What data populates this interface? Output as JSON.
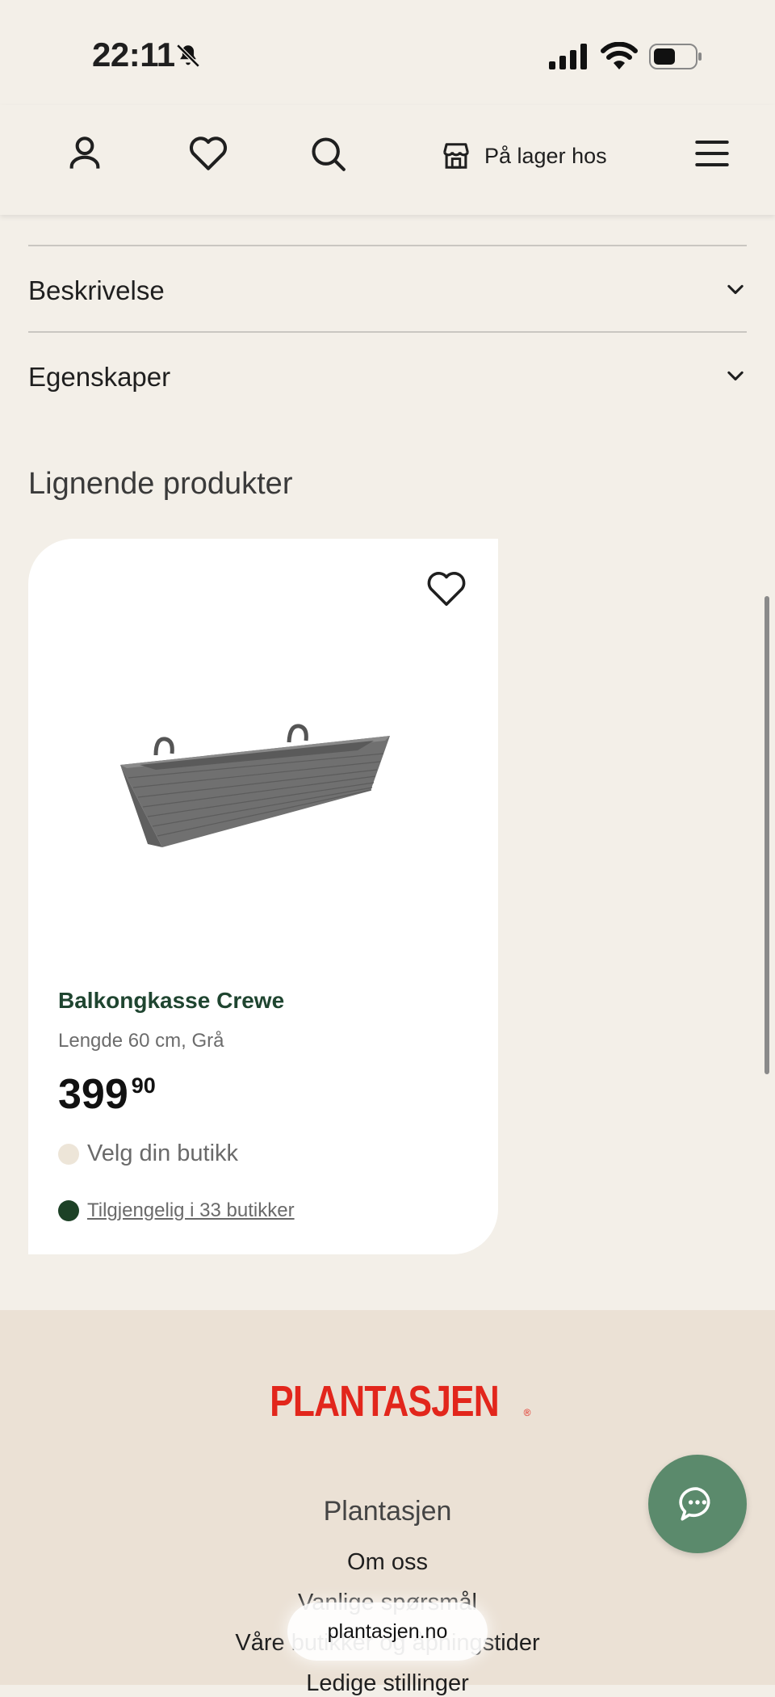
{
  "status_bar": {
    "time": "22:11"
  },
  "header": {
    "icons": [
      "user-icon",
      "heart-icon",
      "search-icon",
      "store-icon",
      "menu-icon"
    ],
    "store_label": "På lager hos"
  },
  "accordion": [
    {
      "label": "Beskrivelse"
    },
    {
      "label": "Egenskaper"
    }
  ],
  "similar_products": {
    "title": "Lignende produkter",
    "products": [
      {
        "name": "Balkongkasse Crewe",
        "variant": "Lengde 60 cm, Grå",
        "price_main": "399",
        "price_decimals": "90",
        "store_prompt": "Velg din butikk",
        "availability": "Tilgjengelig i 33 butikker"
      }
    ]
  },
  "footer": {
    "logo": "PLANTASJEN",
    "section_title": "Plantasjen",
    "links": [
      "Om oss",
      "Vanlige spørsmål",
      "Våre butikker og åpningstider",
      "Ledige stillinger"
    ]
  },
  "browser": {
    "url": "plantasjen.no"
  },
  "colors": {
    "brand_red": "#e2261c",
    "brand_green": "#1f4530",
    "chat": "#5b8a6c"
  }
}
